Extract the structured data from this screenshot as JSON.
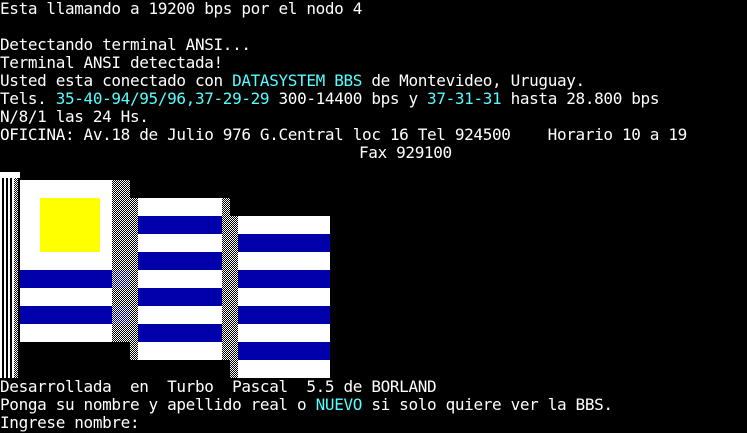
{
  "terminal": {
    "background": "#000000",
    "text_color": "#ffffff",
    "highlight_color": "#55ffff",
    "lines": {
      "connect": "Esta llamando a 19200 bps por el nodo 4",
      "detecting": "Detectando terminal ANSI...",
      "detected": "Terminal ANSI detectada!",
      "connected_prefix": "Usted esta conectado con ",
      "bbs_name": "DATASYSTEM BBS",
      "connected_suffix": " de Montevideo, Uruguay.",
      "tels_prefix": "Tels. ",
      "tels_numbers_1": "35-40-94/95/96,37-29-29",
      "tels_mid": " 300-14400 bps y ",
      "tels_numbers_2": "37-31-31",
      "tels_suffix": " hasta 28.800 bps",
      "params": "N/8/1 las 24 Hs.",
      "office": "OFICINA: Av.18 de Julio 976 G.Central loc 16 Tel 924500    Horario 10 a 19",
      "fax": "Fax 929100",
      "developed": "Desarrollada  en  Turbo  Pascal  5.5 de BORLAND",
      "prompt_prefix": "Ponga su nombre y apellido real o ",
      "prompt_new": "NUEVO",
      "prompt_suffix": " si solo quiere ver la BBS.",
      "name_prompt": "Ingrese nombre: "
    }
  },
  "flag_art": {
    "country": "Uruguay",
    "sun_color": "#ffff00",
    "stripe_blue": "#0000aa",
    "stripe_white": "#ffffff",
    "pole_color": "#ffffff"
  }
}
